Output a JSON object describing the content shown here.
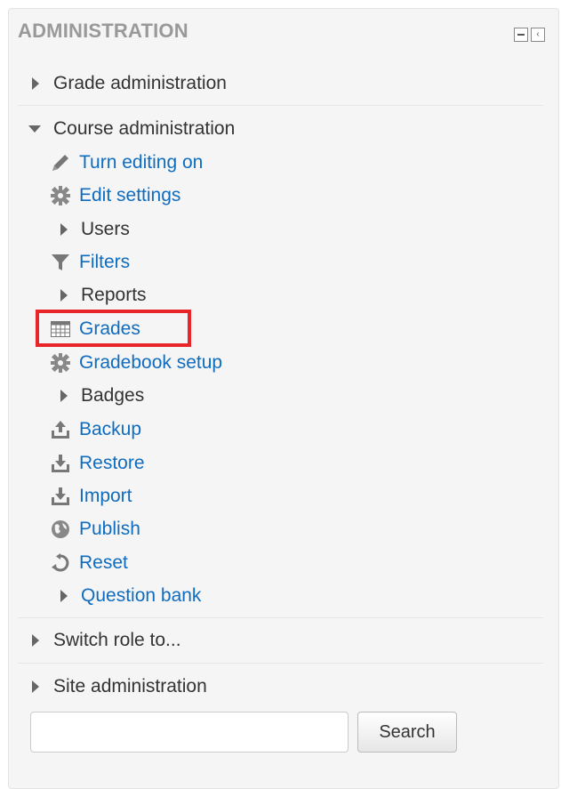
{
  "block": {
    "title": "ADMINISTRATION",
    "controls": {
      "collapse_icon": "minus-box-icon",
      "dock_icon": "dock-left-icon"
    }
  },
  "tree": {
    "grade_admin": "Grade administration",
    "course_admin": {
      "label": "Course administration",
      "items": [
        {
          "label": "Turn editing on",
          "icon": "pencil-icon"
        },
        {
          "label": "Edit settings",
          "icon": "gear-icon"
        },
        {
          "label": "Users",
          "icon": "triangle-right-icon"
        },
        {
          "label": "Filters",
          "icon": "filter-icon"
        },
        {
          "label": "Reports",
          "icon": "triangle-right-icon"
        },
        {
          "label": "Grades",
          "icon": "table-icon"
        },
        {
          "label": "Gradebook setup",
          "icon": "gear-icon"
        },
        {
          "label": "Badges",
          "icon": "triangle-right-icon"
        },
        {
          "label": "Backup",
          "icon": "upload-icon"
        },
        {
          "label": "Restore",
          "icon": "download-icon"
        },
        {
          "label": "Import",
          "icon": "download-icon"
        },
        {
          "label": "Publish",
          "icon": "globe-icon"
        },
        {
          "label": "Reset",
          "icon": "refresh-icon"
        },
        {
          "label": "Question bank",
          "icon": "triangle-right-icon"
        }
      ]
    },
    "switch_role": "Switch role to...",
    "site_admin": "Site administration"
  },
  "search": {
    "placeholder": "",
    "value": "",
    "button_label": "Search"
  },
  "colors": {
    "link": "#0f6cbf",
    "text": "#333333",
    "header": "#999999",
    "highlight": "#e8262a"
  }
}
